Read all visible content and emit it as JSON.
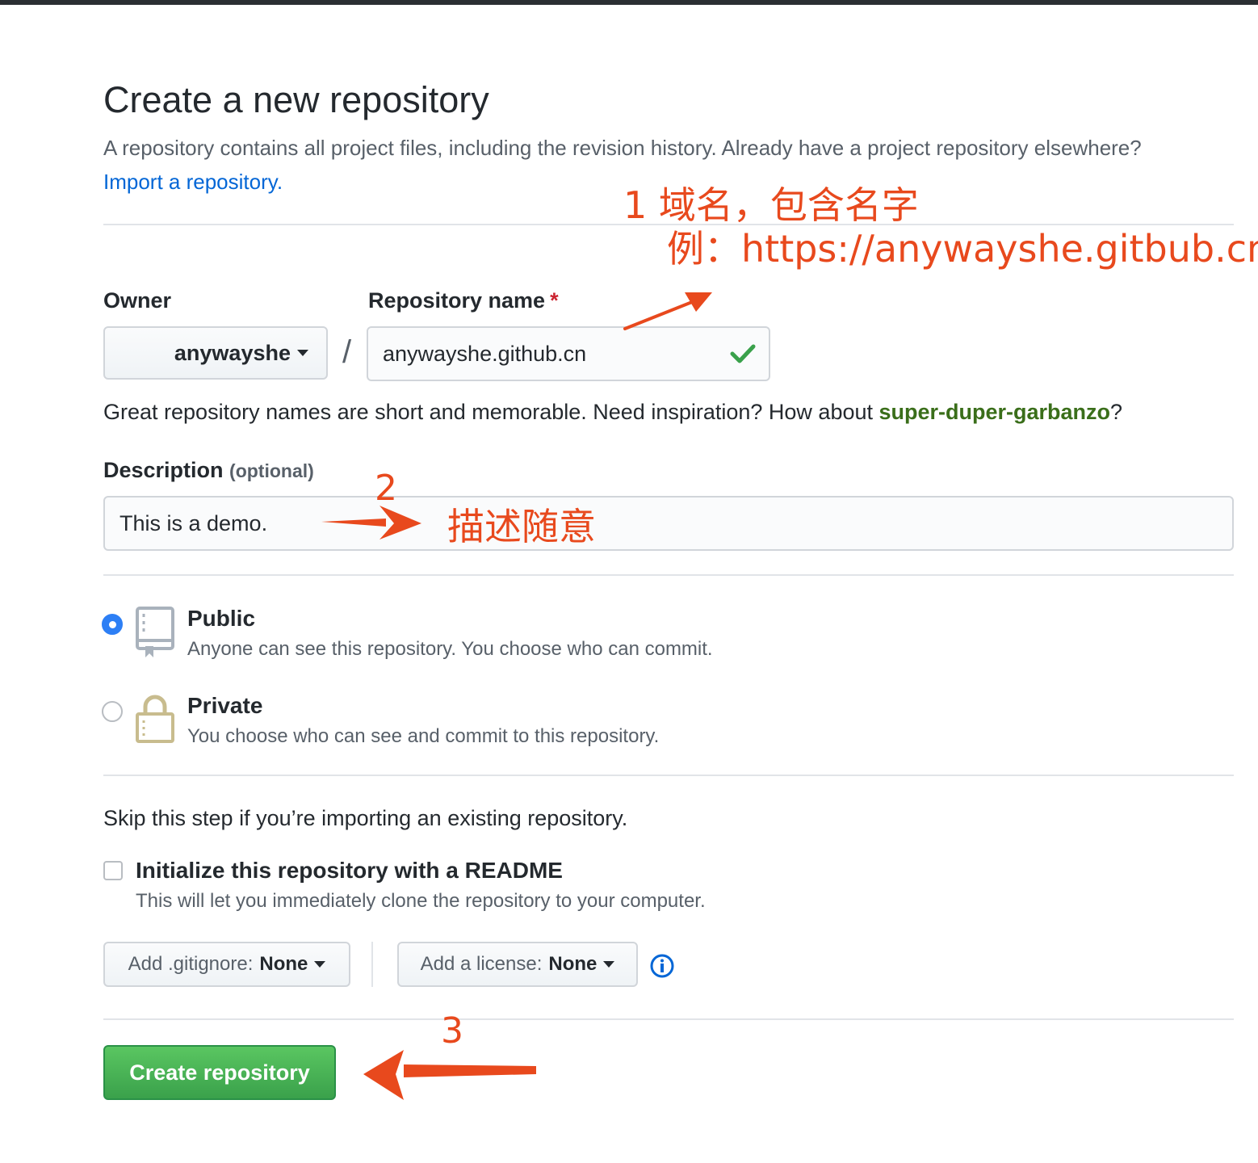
{
  "header": {
    "title": "Create a new repository",
    "subtitle": "A repository contains all project files, including the revision history. Already have a project repository elsewhere?",
    "import_link": "Import a repository."
  },
  "owner": {
    "label": "Owner",
    "value": "anywayshe"
  },
  "repo": {
    "label": "Repository name",
    "required_mark": "*",
    "separator": "/",
    "value": "anywayshe.github.cn"
  },
  "hint": {
    "text": "Great repository names are short and memorable. Need inspiration? How about",
    "suggestion": "super-duper-garbanzo",
    "end": "?"
  },
  "description": {
    "label": "Description",
    "optional": "(optional)",
    "value": "This is a demo."
  },
  "visibility": {
    "selected": "public",
    "public": {
      "title": "Public",
      "note": "Anyone can see this repository. You choose who can commit."
    },
    "private": {
      "title": "Private",
      "note": "You choose who can see and commit to this repository."
    }
  },
  "init": {
    "skip_text": "Skip this step if you’re importing an existing repository.",
    "readme_label": "Initialize this repository with a README",
    "readme_note": "This will let you immediately clone the repository to your computer.",
    "readme_checked": false
  },
  "gitignore": {
    "label": "Add .gitignore:",
    "value": "None"
  },
  "license": {
    "label": "Add a license:",
    "value": "None"
  },
  "create_button": "Create repository",
  "annotations": {
    "a1_line1": "1  域名，包含名字",
    "a1_line2": "例：https://anywayshe.gitbub.cn",
    "a2_num": "2",
    "a2_text": "描述随意",
    "a3_num": "3"
  },
  "colors": {
    "link": "#0366d6",
    "primary_button": "#3aa14b",
    "annotation": "#e8491d",
    "radio_selected": "#2d7ff5"
  },
  "icons": {
    "check": "check-icon",
    "repo": "repo-book-icon",
    "lock": "lock-icon",
    "info": "info-icon"
  }
}
